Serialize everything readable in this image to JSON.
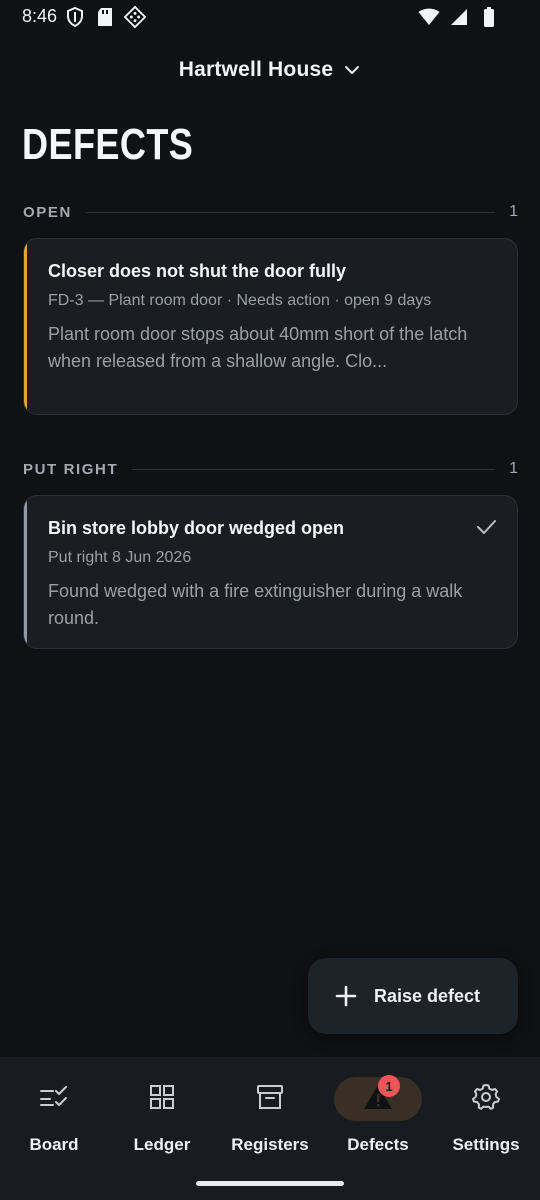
{
  "status_bar": {
    "time": "8:46",
    "left_icons": [
      "shield-icon",
      "sd-card-icon",
      "diamond-grid-icon"
    ],
    "right_icons": [
      "wifi-icon",
      "signal-icon",
      "battery-icon"
    ]
  },
  "header": {
    "site_name": "Hartwell House",
    "page_title": "DEFECTS"
  },
  "colors": {
    "open_accent": "#e0a63a",
    "put_right_accent": "#8e9aa8",
    "badge": "#f0555a",
    "active_nav_bg": "#3a2f24"
  },
  "sections": {
    "open": {
      "label": "OPEN",
      "count": "1",
      "cards": [
        {
          "title": "Closer does not shut the door fully",
          "meta": "FD-3 — Plant room door · Needs action · open 9 days",
          "description": "Plant room door stops about 40mm short of the latch when released from a shallow angle. Clo..."
        }
      ]
    },
    "put_right": {
      "label": "PUT RIGHT",
      "count": "1",
      "cards": [
        {
          "title": "Bin store lobby door wedged open",
          "meta": "Put right 8 Jun 2026",
          "description": "Found wedged with a fire extinguisher during a walk round.",
          "icon": "check-icon"
        }
      ]
    }
  },
  "fab": {
    "label": "Raise defect",
    "icon": "plus-icon"
  },
  "bottom_nav": {
    "items": [
      {
        "label": "Board",
        "icon": "checklist-icon"
      },
      {
        "label": "Ledger",
        "icon": "grid-icon"
      },
      {
        "label": "Registers",
        "icon": "archive-icon"
      },
      {
        "label": "Defects",
        "icon": "warning-icon",
        "active": true,
        "badge": "1"
      },
      {
        "label": "Settings",
        "icon": "gear-icon"
      }
    ]
  }
}
